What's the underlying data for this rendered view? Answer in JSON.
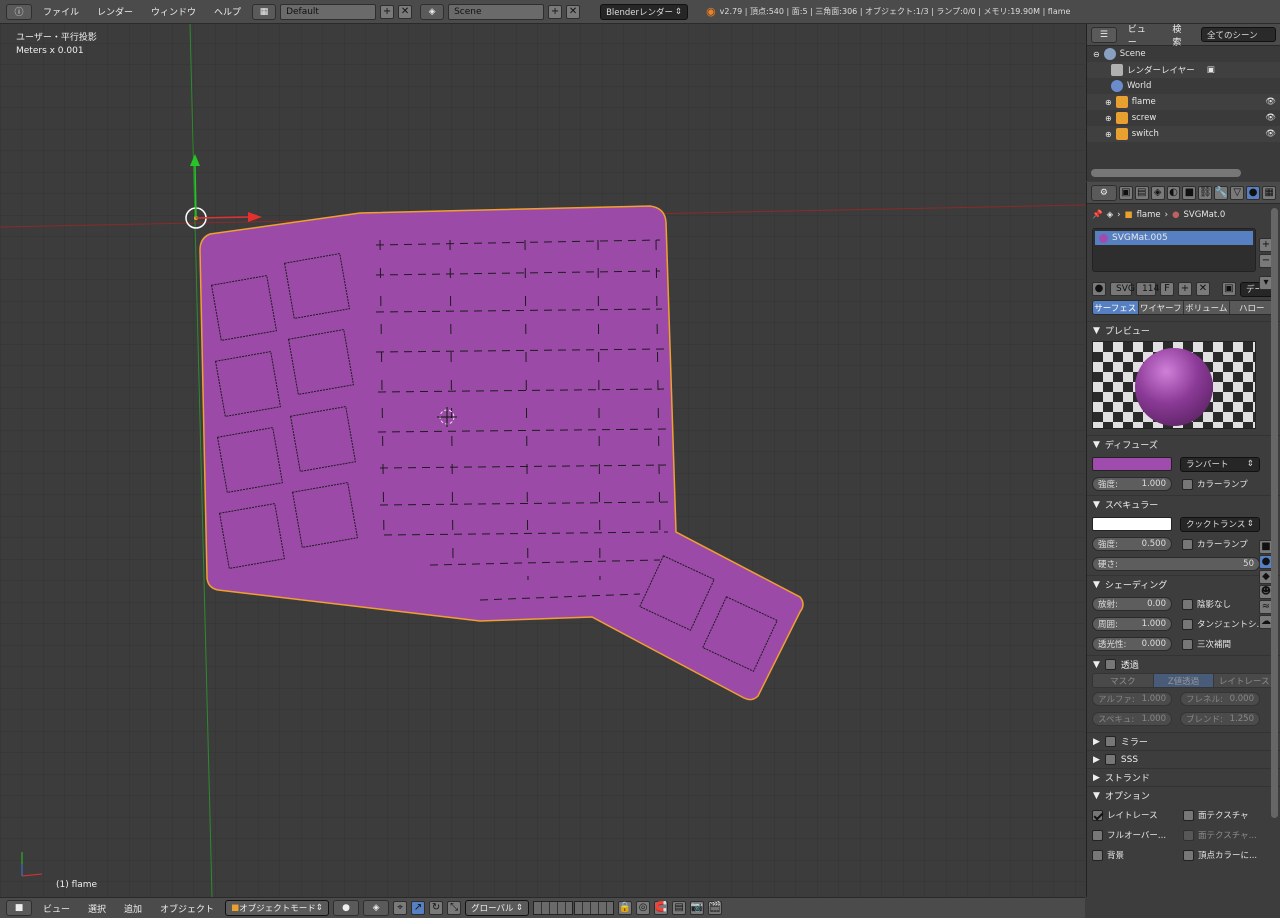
{
  "header": {
    "info_icon": "info-icon",
    "menus": [
      "ファイル",
      "レンダー",
      "ウィンドウ",
      "ヘルプ"
    ],
    "layout": "Default",
    "scene": "Scene",
    "engine": "Blenderレンダー",
    "stats": "v2.79 | 頂点:540 | 面:5 | 三角面:306 | オブジェクト:1/3 | ランプ:0/0 | メモリ:19.90M | flame"
  },
  "viewport": {
    "view_name": "ユーザー・平行投影",
    "units": "Meters x 0.001",
    "object_label": "(1) flame",
    "mesh_color": "#9b4aa8",
    "outline_color": "#f0a030"
  },
  "outliner": {
    "tabs": [
      "ビュー",
      "検索",
      "全てのシーン"
    ],
    "items": [
      {
        "label": "Scene",
        "icon": "scene-icon"
      },
      {
        "label": "レンダーレイヤー",
        "icon": "render-layer-icon"
      },
      {
        "label": "World",
        "icon": "world-icon"
      },
      {
        "label": "flame",
        "icon": "mesh-icon"
      },
      {
        "label": "screw",
        "icon": "mesh-icon"
      },
      {
        "label": "switch",
        "icon": "mesh-icon"
      }
    ]
  },
  "properties": {
    "breadcrumb": {
      "object": "flame",
      "material": "SVGMat.0"
    },
    "material_slot": "SVGMat.005",
    "datablock": {
      "name": "SVG",
      "users": "114",
      "fake": "F"
    },
    "data_dropdown": "デー",
    "tabs": [
      "サーフェス",
      "ワイヤーフ",
      "ボリューム",
      "ハロー"
    ],
    "preview_title": "プレビュー",
    "diffuse": {
      "title": "ディフューズ",
      "color": "#a04cae",
      "shader": "ランバート",
      "intensity_label": "強度:",
      "intensity": "1.000",
      "ramp": "カラーランプ"
    },
    "specular": {
      "title": "スペキュラー",
      "color": "#ffffff",
      "shader": "クックトランス",
      "intensity_label": "強度:",
      "intensity": "0.500",
      "ramp": "カラーランプ",
      "hardness_label": "硬さ:",
      "hardness": "50"
    },
    "shading": {
      "title": "シェーディング",
      "emit_label": "放射:",
      "emit": "0.00",
      "shadeless": "陰影なし",
      "ambient_label": "周囲:",
      "ambient": "1.000",
      "tangent": "タンジェントシ...",
      "translucency_label": "透光性:",
      "translucency": "0.000",
      "cubic": "三次補間"
    },
    "transparency": {
      "title": "透過",
      "modes": [
        "マスク",
        "Z値透過",
        "レイトレース"
      ],
      "alpha_label": "アルファ:",
      "alpha": "1.000",
      "fresnel_label": "フレネル:",
      "fresnel": "0.000",
      "specular_label": "スペキュ:",
      "specular": "1.000",
      "blend_label": "ブレンド:",
      "blend": "1.250"
    },
    "mirror": "ミラー",
    "sss": "SSS",
    "strand": "ストランド",
    "options": {
      "title": "オプション",
      "raytrace": "レイトレース",
      "face_texture": "面テクスチャ",
      "full_oversampling": "フルオーバー...",
      "face_texture_alpha": "面テクスチャ...",
      "sky": "背景",
      "vertex_color": "頂点カラーに..."
    }
  },
  "footer": {
    "menus": [
      "ビュー",
      "選択",
      "追加",
      "オブジェクト"
    ],
    "mode": "オブジェクトモード",
    "orientation": "グローバル"
  }
}
